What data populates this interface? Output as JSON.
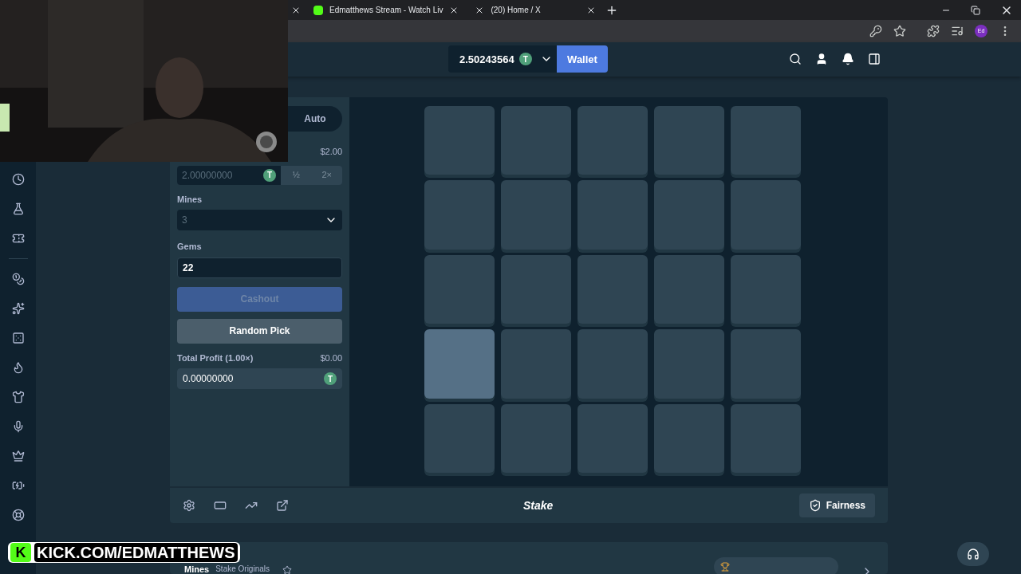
{
  "browser": {
    "tabs": [
      {
        "title": "Edmatthews Stream - Watch Liv"
      },
      {
        "title": "(20) Home / X"
      }
    ],
    "profile": "Ed"
  },
  "header": {
    "balance": "2.50243564",
    "coin": "T",
    "wallet": "Wallet"
  },
  "game": {
    "mode_tab": "Auto",
    "bet_usd": "$2.00",
    "bet": "2.00000000",
    "coin": "T",
    "half": "½",
    "double": "2×",
    "bet_disabled": true,
    "mines_label": "Mines",
    "mines": "3",
    "mines_disabled": true,
    "gems_label": "Gems",
    "gems": "22",
    "cashout": "Cashout",
    "cashout_disabled": true,
    "random_pick": "Random Pick",
    "profit_label": "Total Profit (1.00×)",
    "profit_usd": "$0.00",
    "profit": "0.00000000",
    "profit_coin": "T",
    "tiles": [
      {
        "hovered": false
      },
      {
        "hovered": false
      },
      {
        "hovered": false
      },
      {
        "hovered": false
      },
      {
        "hovered": false
      },
      {
        "hovered": false
      },
      {
        "hovered": false
      },
      {
        "hovered": false
      },
      {
        "hovered": false
      },
      {
        "hovered": false
      },
      {
        "hovered": false
      },
      {
        "hovered": false
      },
      {
        "hovered": false
      },
      {
        "hovered": false
      },
      {
        "hovered": false
      },
      {
        "hovered": true
      },
      {
        "hovered": false
      },
      {
        "hovered": false
      },
      {
        "hovered": false
      },
      {
        "hovered": false
      },
      {
        "hovered": false
      },
      {
        "hovered": false
      },
      {
        "hovered": false
      },
      {
        "hovered": false
      },
      {
        "hovered": false
      }
    ]
  },
  "footer": {
    "logo": "Stake",
    "fairness": "Fairness"
  },
  "info": {
    "title": "Mines",
    "subtitle": "Stake Originals"
  },
  "overlay": {
    "badge": "K",
    "text": "KICK.COM/EDMATTHEWS"
  }
}
